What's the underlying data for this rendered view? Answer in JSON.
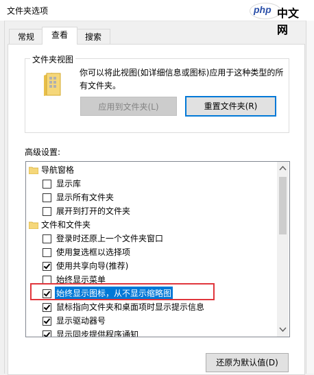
{
  "window": {
    "title": "文件夹选项"
  },
  "watermark": {
    "text_latin": "php",
    "text_cn": "中文网"
  },
  "tabs": [
    {
      "label": "常规",
      "active": false
    },
    {
      "label": "查看",
      "active": true
    },
    {
      "label": "搜索",
      "active": false
    }
  ],
  "folder_views": {
    "title": "文件夹视图",
    "desc_line1": "你可以将此视图(如详细信息或图标)应用于这种类型的所",
    "desc_line2": "有文件夹。",
    "apply_label": "应用到文件夹(L)",
    "reset_label": "重置文件夹(R)"
  },
  "advanced": {
    "label": "高级设置:",
    "items": [
      {
        "type": "group",
        "label": "导航窗格"
      },
      {
        "type": "checkbox",
        "label": "显示库",
        "checked": false
      },
      {
        "type": "checkbox",
        "label": "显示所有文件夹",
        "checked": false
      },
      {
        "type": "checkbox",
        "label": "展开到打开的文件夹",
        "checked": false
      },
      {
        "type": "group",
        "label": "文件和文件夹"
      },
      {
        "type": "checkbox",
        "label": "登录时还原上一个文件夹窗口",
        "checked": false
      },
      {
        "type": "checkbox",
        "label": "使用复选框以选择项",
        "checked": false
      },
      {
        "type": "checkbox",
        "label": "使用共享向导(推荐)",
        "checked": true
      },
      {
        "type": "checkbox",
        "label": "始终显示菜单",
        "checked": false
      },
      {
        "type": "checkbox",
        "label": "始终显示图标，从不显示缩略图",
        "checked": true,
        "selected": true
      },
      {
        "type": "checkbox",
        "label": "鼠标指向文件夹和桌面项时显示提示信息",
        "checked": true
      },
      {
        "type": "checkbox",
        "label": "显示驱动器号",
        "checked": true
      },
      {
        "type": "checkbox",
        "label": "显示同步提供程序通知",
        "checked": true
      }
    ]
  },
  "footer": {
    "restore_label": "还原为默认值(D)"
  },
  "colors": {
    "accent": "#0078d7",
    "highlight_border": "#e0353b",
    "folder": "#f5d77a"
  }
}
